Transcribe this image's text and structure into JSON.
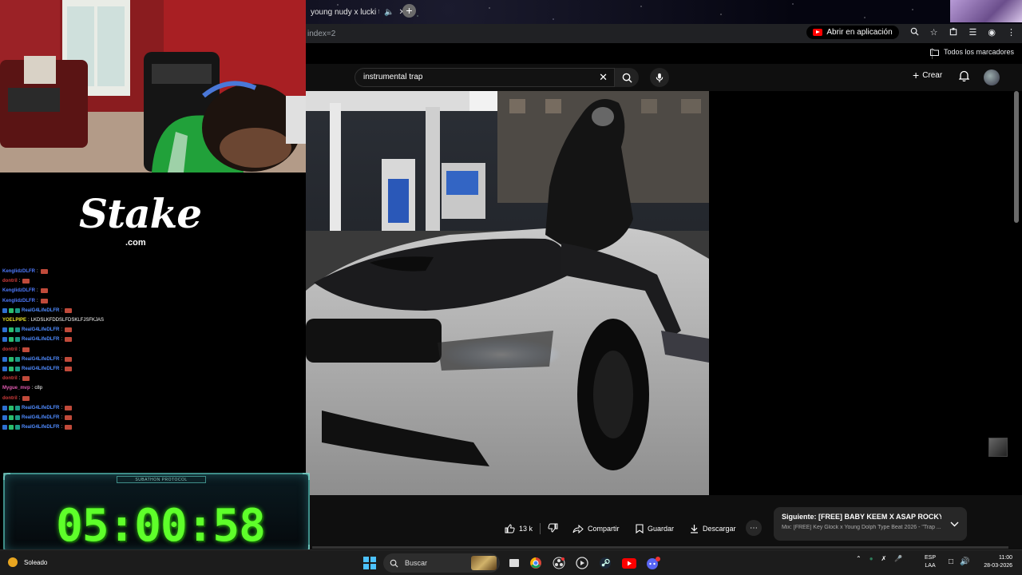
{
  "browser": {
    "tab_title": "young nudy x lucki ty...",
    "url_fragment": "index=2",
    "open_in_app": "Abrir en aplicación",
    "bookmarks_all": "Todos los marcadores"
  },
  "youtube": {
    "search_value": "instrumental trap",
    "create_label": "Crear",
    "likes": "13 k",
    "share_label": "Compartir",
    "save_label": "Guardar",
    "download_label": "Descargar",
    "next_title": "Siguiente: [FREE] BABY KEEM X ASAP ROCKY TYP...",
    "next_subtitle": "Mix: [FREE] Key Glock x Young Dolph Type Beat 2026 - \"Trap ..."
  },
  "stream": {
    "sponsor_logo": "Stake",
    "sponsor_tld": ".com",
    "timer_caption": "SUBATHON PROTOCOL",
    "timer_value": "05:00:58",
    "chat": [
      {
        "user": "KenglidzDLFR",
        "msg": "",
        "color": "#4f7bff",
        "badges": 0,
        "emote": true
      },
      {
        "user": "dontril",
        "msg": "",
        "color": "#d23c3c",
        "badges": 0,
        "emote": true
      },
      {
        "user": "KenglidzDLFR",
        "msg": "",
        "color": "#4f7bff",
        "badges": 0,
        "emote": true
      },
      {
        "user": "KenglidzDLFR",
        "msg": "",
        "color": "#4f7bff",
        "badges": 0,
        "emote": true
      },
      {
        "user": "RealG4LifeDLFR",
        "msg": "",
        "color": "#4f8bff",
        "badges": 3,
        "emote": true
      },
      {
        "user": "YOELPIPE",
        "msg": "LKDSLKFDDSLFDSKLFJSFKJAS",
        "color": "#e6e22b",
        "badges": 0,
        "emote": false
      },
      {
        "user": "RealG4LifeDLFR",
        "msg": "",
        "color": "#4f8bff",
        "badges": 3,
        "emote": true
      },
      {
        "user": "RealG4LifeDLFR",
        "msg": "",
        "color": "#4f8bff",
        "badges": 3,
        "emote": true
      },
      {
        "user": "dontril",
        "msg": "",
        "color": "#d23c3c",
        "badges": 0,
        "emote": true
      },
      {
        "user": "RealG4LifeDLFR",
        "msg": "",
        "color": "#4f8bff",
        "badges": 3,
        "emote": true
      },
      {
        "user": "RealG4LifeDLFR",
        "msg": "",
        "color": "#4f8bff",
        "badges": 3,
        "emote": true
      },
      {
        "user": "dontril",
        "msg": "",
        "color": "#d23c3c",
        "badges": 0,
        "emote": true
      },
      {
        "user": "Mygue_mvp",
        "msg": "c8p",
        "color": "#e05ab0",
        "badges": 0,
        "emote": false
      },
      {
        "user": "dontril",
        "msg": "",
        "color": "#d23c3c",
        "badges": 0,
        "emote": true
      },
      {
        "user": "RealG4LifeDLFR",
        "msg": "",
        "color": "#4f8bff",
        "badges": 3,
        "emote": true
      },
      {
        "user": "RealG4LifeDLFR",
        "msg": "",
        "color": "#4f8bff",
        "badges": 3,
        "emote": true
      },
      {
        "user": "RealG4LifeDLFR",
        "msg": "",
        "color": "#4f8bff",
        "badges": 3,
        "emote": true
      }
    ]
  },
  "taskbar": {
    "weather": "Soleado",
    "search_label": "Buscar",
    "lang_top": "ESP",
    "lang_bottom": "LAA",
    "time": "11:00",
    "date": "28-03-2026"
  },
  "colors": {
    "timer_green": "#5eff2a",
    "yt_red": "#ff0000",
    "win_blue": "#4cc2ff"
  }
}
